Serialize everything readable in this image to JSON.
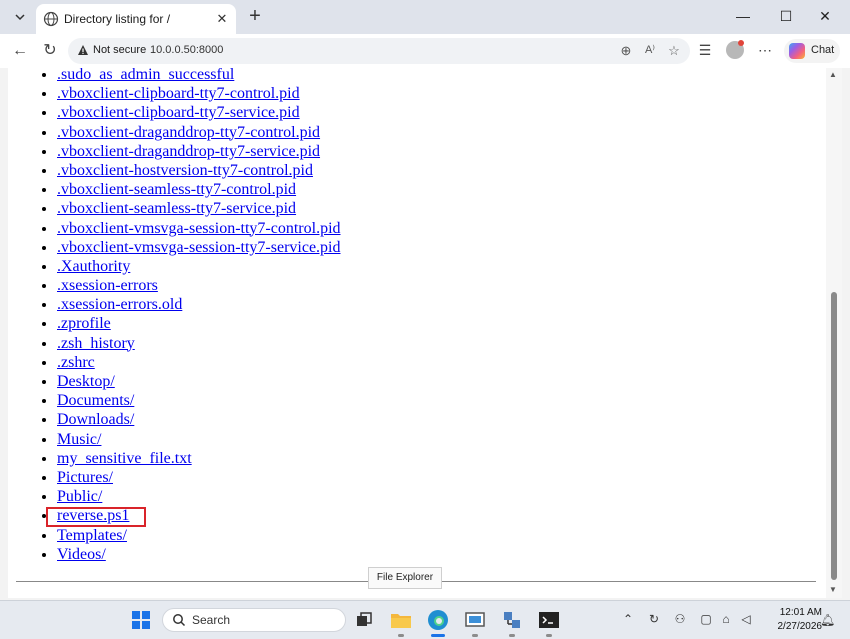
{
  "browser": {
    "tab_title": "Directory listing for /",
    "close_tab_glyph": "✕",
    "new_tab_glyph": "+",
    "address_warning": "Not secure",
    "url": "10.0.0.50:8000",
    "chat_label": "Chat",
    "window_controls": {
      "minimize": "—",
      "maximize": "☐",
      "close": "✕"
    }
  },
  "listing": {
    "items": [
      ".sudo_as_admin_successful",
      ".vboxclient-clipboard-tty7-control.pid",
      ".vboxclient-clipboard-tty7-service.pid",
      ".vboxclient-draganddrop-tty7-control.pid",
      ".vboxclient-draganddrop-tty7-service.pid",
      ".vboxclient-hostversion-tty7-control.pid",
      ".vboxclient-seamless-tty7-control.pid",
      ".vboxclient-seamless-tty7-service.pid",
      ".vboxclient-vmsvga-session-tty7-control.pid",
      ".vboxclient-vmsvga-session-tty7-service.pid",
      ".Xauthority",
      ".xsession-errors",
      ".xsession-errors.old",
      ".zprofile",
      ".zsh_history",
      ".zshrc",
      "Desktop/",
      "Documents/",
      "Downloads/",
      "Music/",
      "my_sensitive_file.txt",
      "Pictures/",
      "Public/",
      "reverse.ps1",
      "Templates/",
      "Videos/"
    ],
    "highlighted_item": "reverse.ps1"
  },
  "tooltip": {
    "text": "File Explorer"
  },
  "taskbar": {
    "search_label": "Search",
    "time": "12:01 AM",
    "date": "2/27/2026"
  },
  "colors": {
    "link": "#0000ee",
    "highlight_border": "#d9242a",
    "tabbar_bg": "#dfe3eb",
    "taskbar_bg": "#e6eaf0"
  }
}
